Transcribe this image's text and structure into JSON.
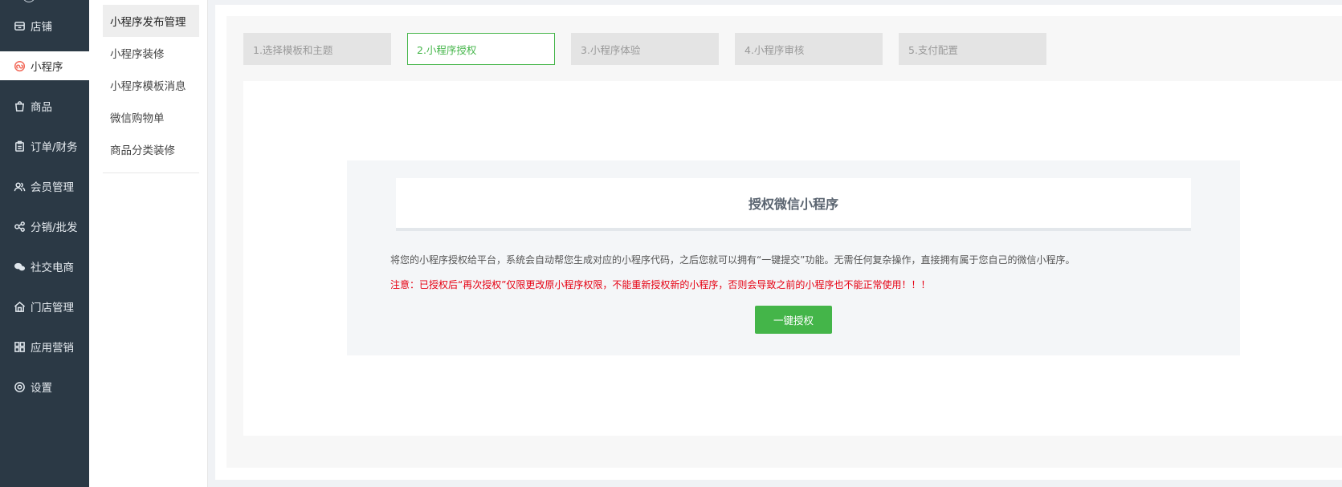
{
  "sidebar": {
    "items": [
      {
        "label": "店铺",
        "icon": "store-icon"
      },
      {
        "label": "小程序",
        "icon": "miniprogram-icon",
        "active": true
      },
      {
        "label": "商品",
        "icon": "shopping-bag-icon"
      },
      {
        "label": "订单/财务",
        "icon": "clipboard-icon"
      },
      {
        "label": "会员管理",
        "icon": "users-icon"
      },
      {
        "label": "分销/批发",
        "icon": "share-nodes-icon"
      },
      {
        "label": "社交电商",
        "icon": "chat-bubbles-icon"
      },
      {
        "label": "门店管理",
        "icon": "house-icon"
      },
      {
        "label": "应用营销",
        "icon": "apps-grid-icon"
      },
      {
        "label": "设置",
        "icon": "gear-icon"
      }
    ]
  },
  "subnav": {
    "items": [
      {
        "label": "小程序发布管理",
        "active": true
      },
      {
        "label": "小程序装修"
      },
      {
        "label": "小程序模板消息"
      },
      {
        "label": "微信购物单"
      },
      {
        "label": "商品分类装修"
      }
    ]
  },
  "steps": [
    {
      "label": "1.选择模板和主题"
    },
    {
      "label": "2.小程序授权",
      "active": true
    },
    {
      "label": "3.小程序体验"
    },
    {
      "label": "4.小程序审核"
    },
    {
      "label": "5.支付配置"
    }
  ],
  "auth": {
    "title": "授权微信小程序",
    "description": "将您的小程序授权给平台，系统会自动帮您生成对应的小程序代码，之后您就可以拥有“一键提交”功能。无需任何复杂操作，直接拥有属于您自己的微信小程序。",
    "warning": "注意：已授权后“再次授权”仅限更改原小程序权限，不能重新授权新的小程序，否则会导致之前的小程序也不能正常使用！！！",
    "button_label": "一键授权"
  },
  "colors": {
    "sidebar_bg": "#2b3945",
    "accent_green": "#44b549",
    "warning_red": "#e60012",
    "active_icon": "#f26a5a"
  }
}
